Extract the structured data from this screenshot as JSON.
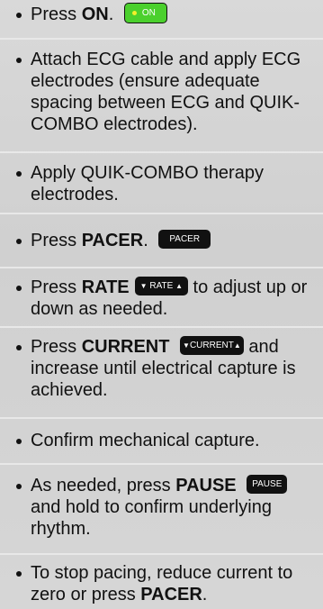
{
  "steps": [
    {
      "pre": "Press ",
      "bold": "ON",
      "post": ".",
      "button": "ON"
    },
    {
      "text": "Attach ECG cable and apply ECG electrodes (ensure adequate spacing between ECG and QUIK-COMBO electrodes)."
    },
    {
      "text": "Apply QUIK-COMBO therapy electrodes."
    },
    {
      "pre": "Press ",
      "bold": "PACER",
      "post": ".",
      "button": "PACER"
    },
    {
      "pre": "Press ",
      "bold": "RATE",
      "button": "RATE",
      "post": " to adjust up or down as needed."
    },
    {
      "pre": "Press ",
      "bold": "CURRENT",
      "button": "CURRENT",
      "post": " and increase until electrical capture is achieved."
    },
    {
      "text": "Confirm mechanical capture."
    },
    {
      "pre": "As needed, press ",
      "bold": "PAUSE",
      "button": "PAUSE",
      "post": " and hold to confirm underlying rhythm."
    },
    {
      "pre": "To stop pacing, reduce current to zero or press ",
      "bold": "PACER",
      "post": "."
    }
  ]
}
